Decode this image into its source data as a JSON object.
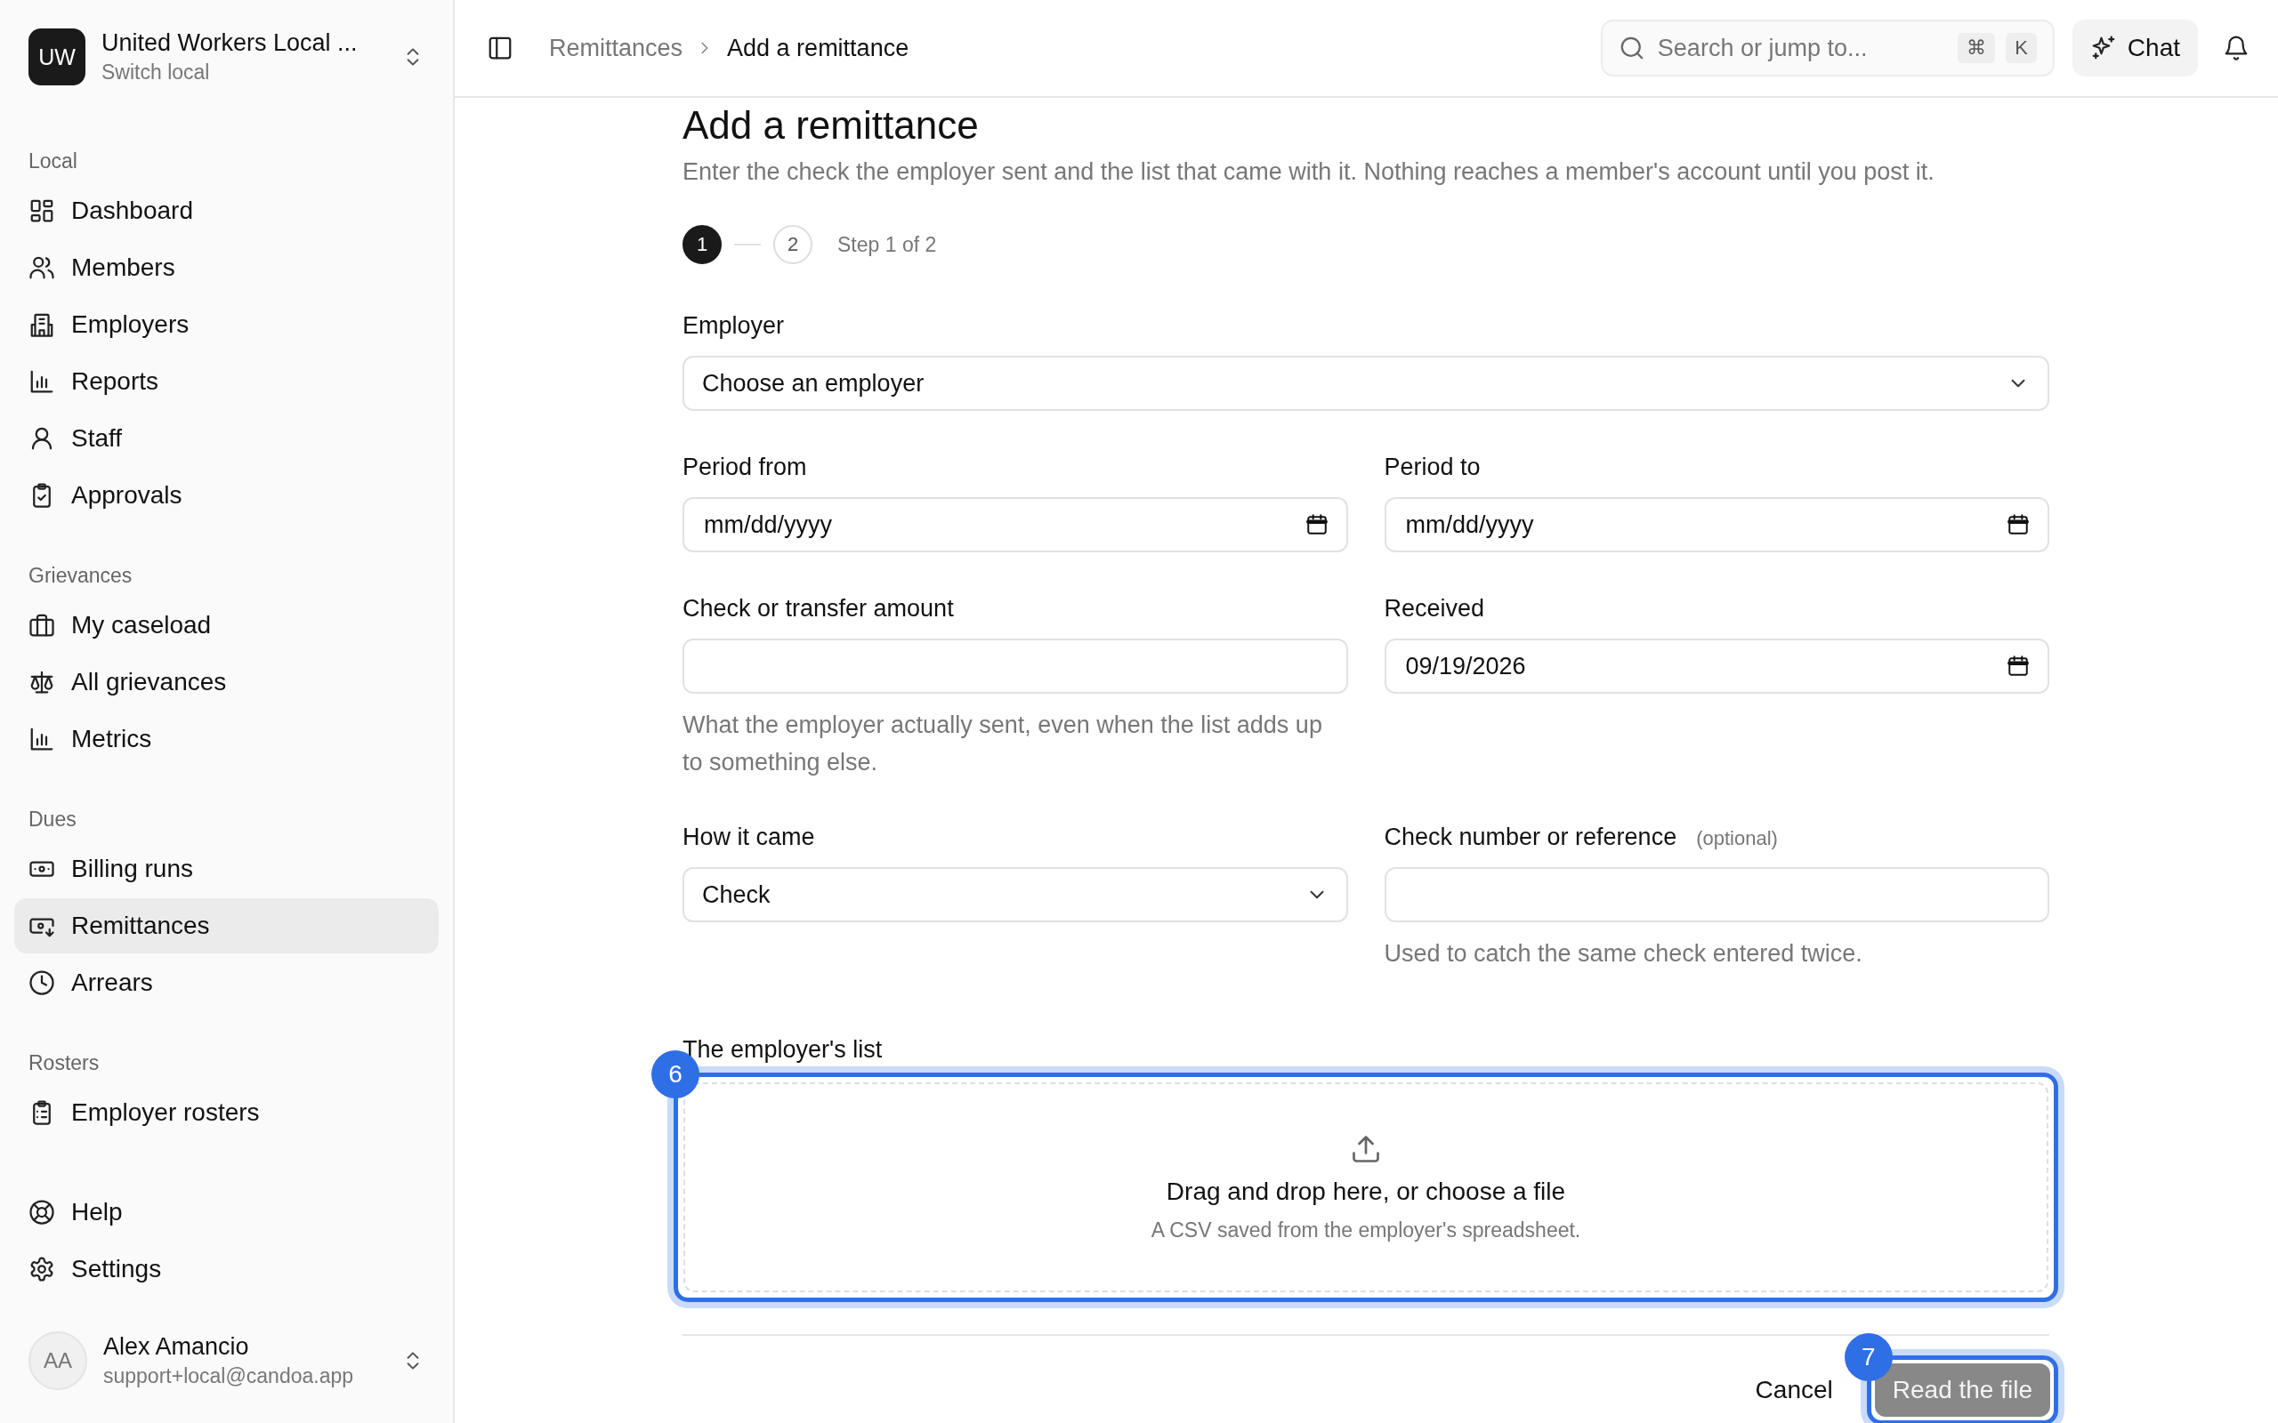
{
  "sidebar": {
    "org": {
      "initials": "UW",
      "name": "United Workers Local ...",
      "subtitle": "Switch local"
    },
    "sections": [
      {
        "title": "Local",
        "items": [
          {
            "label": "Dashboard",
            "selected": false
          },
          {
            "label": "Members",
            "selected": false
          },
          {
            "label": "Employers",
            "selected": false
          },
          {
            "label": "Reports",
            "selected": false
          },
          {
            "label": "Staff",
            "selected": false
          },
          {
            "label": "Approvals",
            "selected": false
          }
        ]
      },
      {
        "title": "Grievances",
        "items": [
          {
            "label": "My caseload",
            "selected": false
          },
          {
            "label": "All grievances",
            "selected": false
          },
          {
            "label": "Metrics",
            "selected": false
          }
        ]
      },
      {
        "title": "Dues",
        "items": [
          {
            "label": "Billing runs",
            "selected": false
          },
          {
            "label": "Remittances",
            "selected": true
          },
          {
            "label": "Arrears",
            "selected": false
          }
        ]
      },
      {
        "title": "Rosters",
        "items": [
          {
            "label": "Employer rosters",
            "selected": false
          }
        ]
      }
    ],
    "footer_items": [
      {
        "label": "Help",
        "selected": false
      },
      {
        "label": "Settings",
        "selected": false
      }
    ],
    "user": {
      "initials": "AA",
      "name": "Alex Amancio",
      "email": "support+local@candoa.app"
    }
  },
  "header": {
    "breadcrumbs": [
      "Remittances",
      "Add a remittance"
    ],
    "search": {
      "placeholder": "Search or jump to...",
      "keys": [
        "⌘",
        "K"
      ]
    },
    "chat_button": "Chat"
  },
  "page": {
    "title": "Add a remittance",
    "subtitle": "Enter the check the employer sent and the list that came with it. Nothing reaches a member's account until you post it.",
    "steps": [
      {
        "label": "1",
        "selected": true
      },
      {
        "label": "2",
        "selected": false
      }
    ],
    "step_text": "Step 1 of 2",
    "rows": [
      [
        {
          "kind": "select",
          "label": "Employer",
          "value": "Choose an employer"
        }
      ],
      [
        {
          "kind": "date",
          "label": "Period from",
          "placeholder": "mm/dd/yyyy"
        },
        {
          "kind": "date",
          "label": "Period to",
          "placeholder": "mm/dd/yyyy"
        }
      ],
      [
        {
          "kind": "text",
          "label": "Check or transfer amount",
          "help": "What the employer actually sent, even when the list adds up to something else."
        },
        {
          "kind": "date",
          "label": "Received",
          "value": "09/19/2026"
        }
      ],
      [
        {
          "kind": "select",
          "label": "How it came",
          "value": "Check"
        },
        {
          "kind": "text",
          "label": "Check number or reference",
          "optional": "(optional)",
          "help": "Used to catch the same check entered twice."
        }
      ]
    ],
    "upload": {
      "label": "The employer's list",
      "title": "Drag and drop here, or choose a file",
      "hint": "A CSV saved from the employer's spreadsheet.",
      "badge": "6"
    },
    "actions": {
      "cancel": "Cancel",
      "submit": {
        "label": "Read the file",
        "disabled": true,
        "badge": "7"
      }
    }
  }
}
